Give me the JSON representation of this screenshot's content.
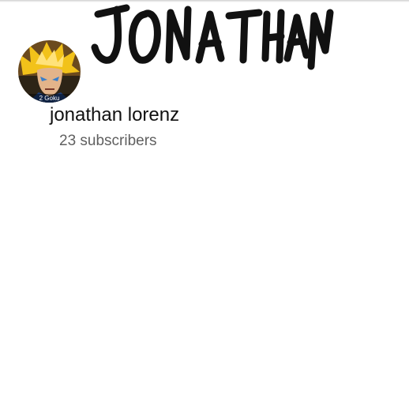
{
  "banner": {
    "text": "JONATHAN"
  },
  "avatar": {
    "caption": "2 Goku",
    "hair_color": "#f2c21a",
    "bg_color": "#6b4a1e"
  },
  "channel": {
    "name": "jonathan lorenz",
    "subscribers": "23 subscribers"
  }
}
